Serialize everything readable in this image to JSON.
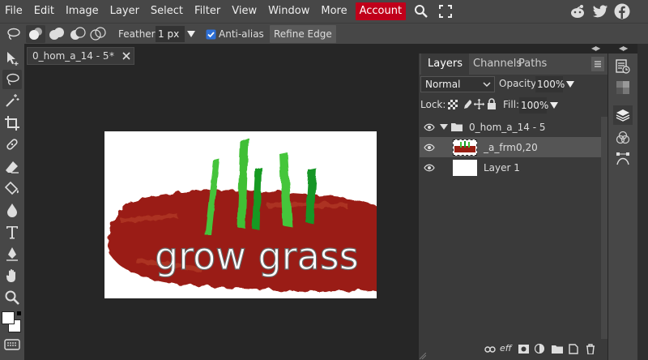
{
  "menubar": {
    "items": [
      "File",
      "Edit",
      "Image",
      "Layer",
      "Select",
      "Filter",
      "View",
      "Window",
      "More"
    ],
    "account": "Account",
    "accent": "#c0001a"
  },
  "options": {
    "feather_label": "Feather:",
    "feather_value": "1 px",
    "antialias_label": "Anti-alias",
    "antialias_checked": true,
    "refine_edge": "Refine Edge"
  },
  "document": {
    "tab_title": "0_hom_a_14 - 5",
    "tab_ellipsis": ".",
    "tab_modified": "*",
    "canvas_text": "grow grass"
  },
  "panel": {
    "tabs": [
      "Layers",
      "Channels",
      "Paths"
    ],
    "blend_mode": "Normal",
    "opacity_label": "Opacity:",
    "opacity_value": "100%",
    "lock_label": "Lock:",
    "fill_label": "Fill:",
    "fill_value": "100%",
    "layers": [
      {
        "name": "0_hom_a_14 - 5",
        "type": "group"
      },
      {
        "name": "_a_frm0,20",
        "type": "layer"
      },
      {
        "name": "Layer 1",
        "type": "layer"
      }
    ],
    "bottom_fx": "eff"
  },
  "icons": {
    "toolbar": [
      "lasso-icon",
      "move-icon",
      "lasso-select-icon",
      "magic-wand-icon",
      "crop-icon",
      "healing-brush-icon",
      "eraser-icon",
      "paint-bucket-icon",
      "blur-drop-icon",
      "type-icon",
      "pen-icon",
      "hand-icon",
      "zoom-icon"
    ],
    "right_dock": [
      "history-icon",
      "swatches-icon",
      "layers-icon",
      "channels-icon",
      "paths-icon"
    ]
  }
}
